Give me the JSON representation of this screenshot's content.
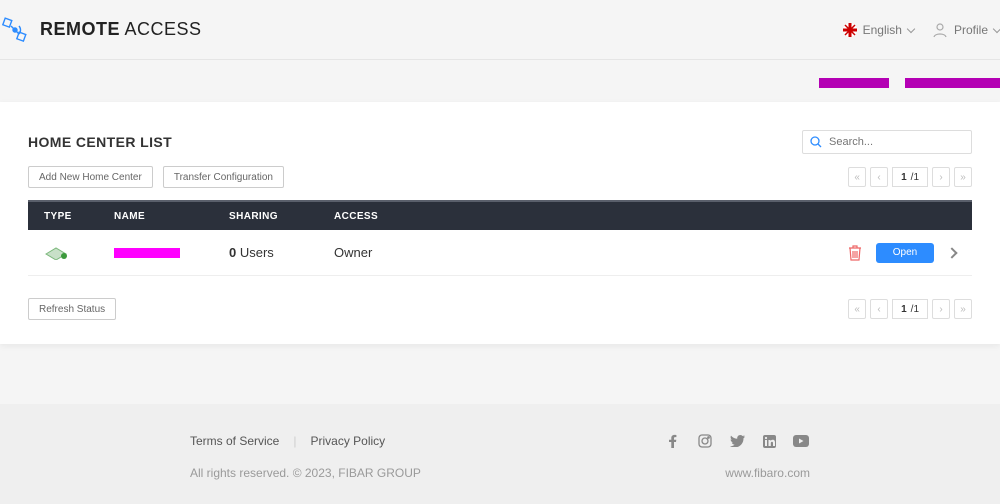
{
  "header": {
    "brand_bold": "REMOTE",
    "brand_light": " ACCESS",
    "language_label": "English",
    "profile_label": "Profile"
  },
  "list": {
    "title": "HOME CENTER LIST",
    "search_placeholder": "Search...",
    "add_button": "Add New Home Center",
    "transfer_button": "Transfer Configuration",
    "refresh_button": "Refresh Status",
    "columns": {
      "type": "TYPE",
      "name": "NAME",
      "sharing": "SHARING",
      "access": "ACCESS"
    },
    "rows": [
      {
        "sharing_count": "0",
        "sharing_label": " Users",
        "access": "Owner",
        "open_label": "Open"
      }
    ],
    "pagination": {
      "current": "1",
      "sep": " / ",
      "total": "1"
    }
  },
  "footer": {
    "terms": "Terms of Service",
    "privacy": "Privacy Policy",
    "copyright": "All rights reserved. © 2023, FIBAR GROUP",
    "site": "www.fibaro.com"
  }
}
